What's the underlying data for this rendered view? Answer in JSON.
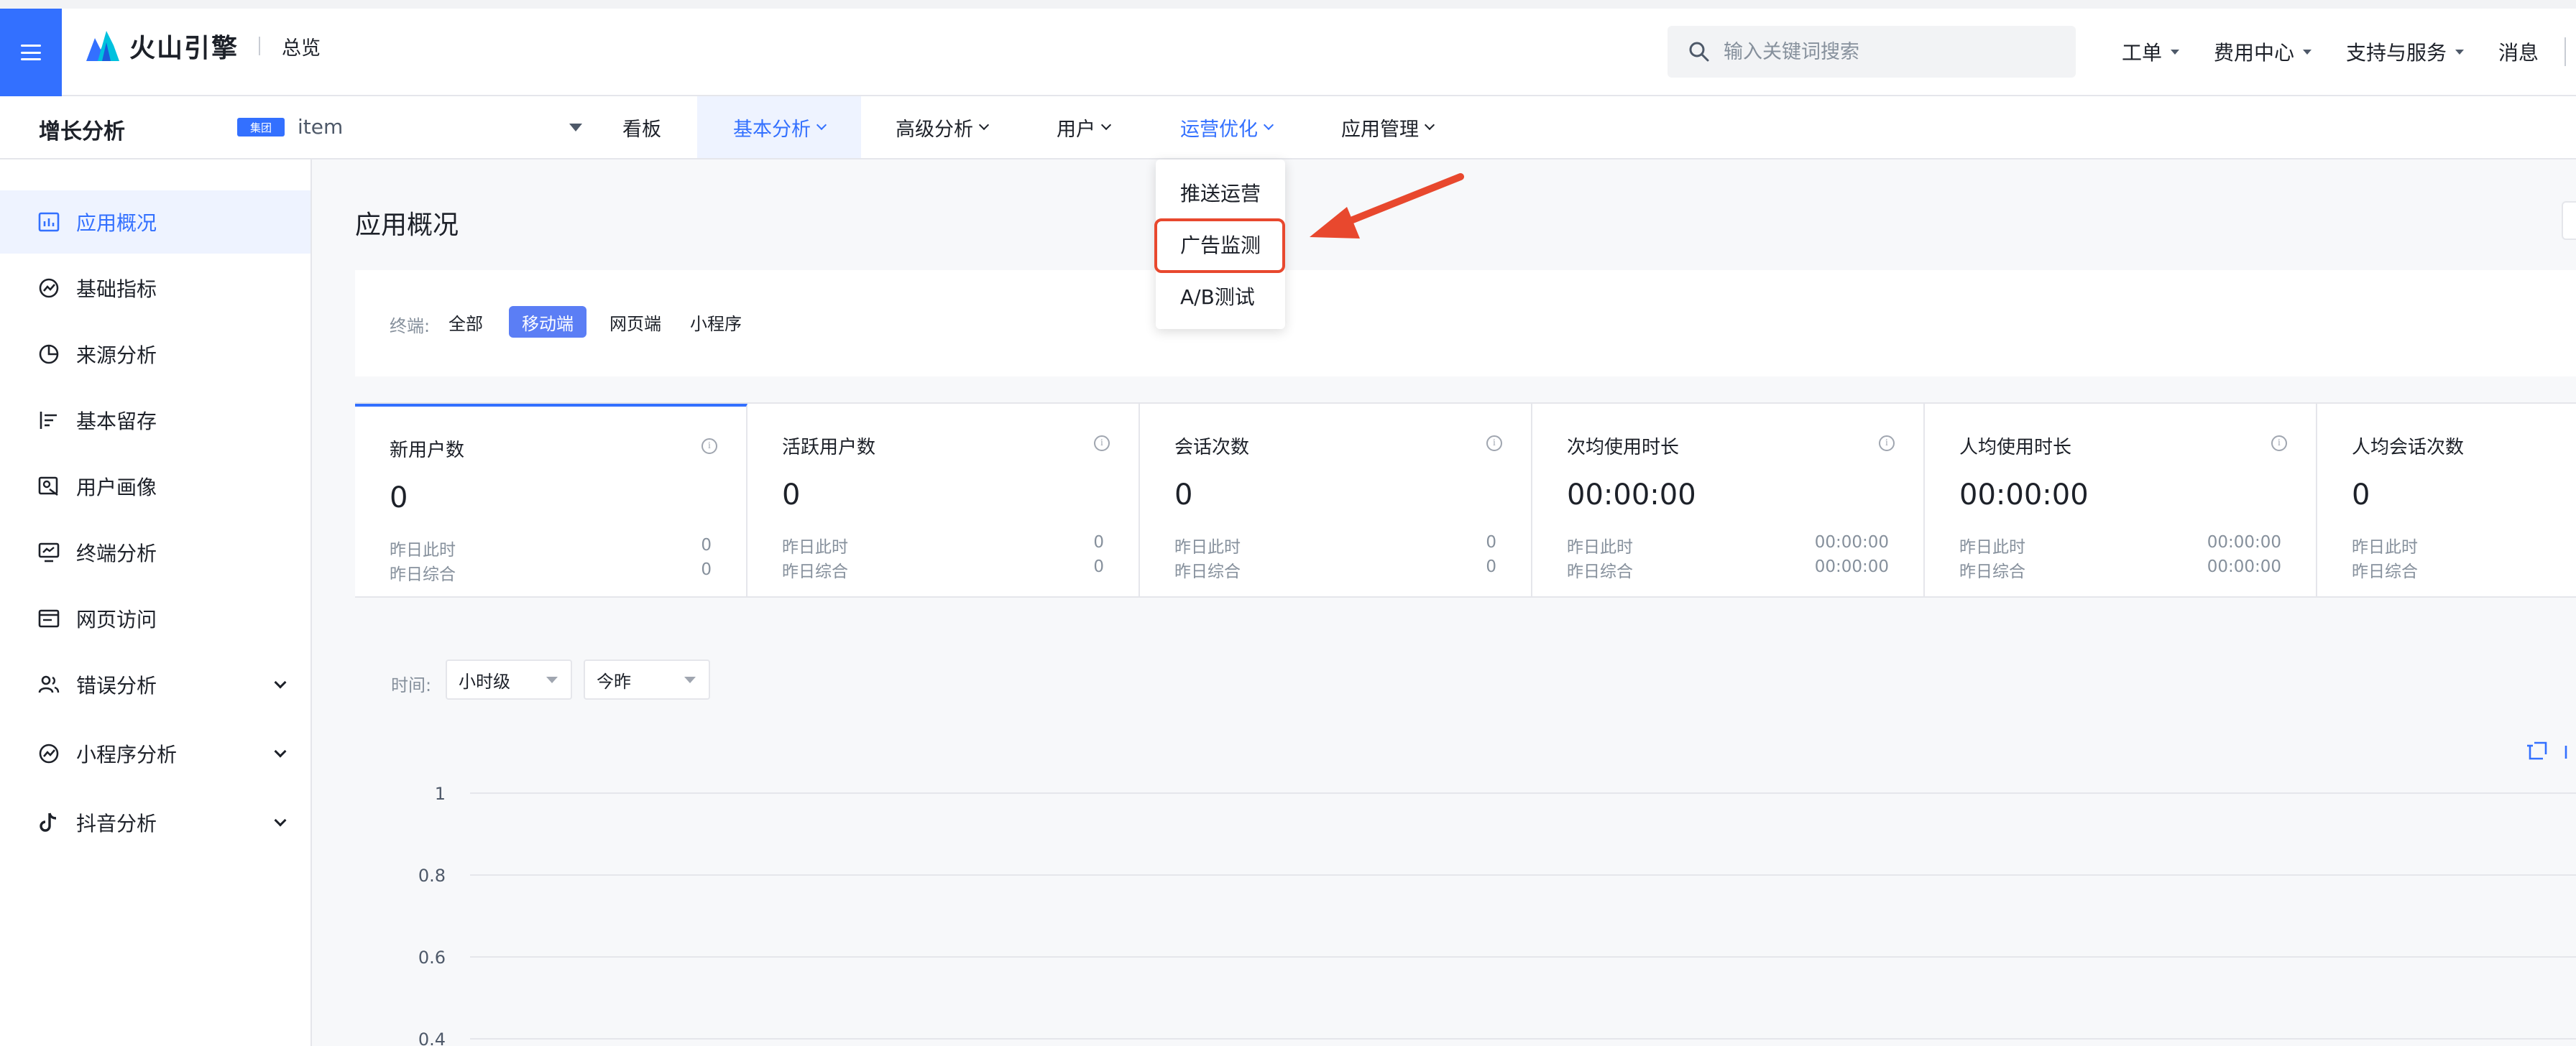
{
  "header": {
    "logo_text": "火山引擎",
    "section": "总览",
    "search_placeholder": "输入关键词搜索",
    "nav": [
      {
        "label": "工单"
      },
      {
        "label": "费用中心"
      },
      {
        "label": "支持与服务"
      },
      {
        "label": "消息"
      }
    ]
  },
  "subbar": {
    "product": "增长分析",
    "group_badge": "集团",
    "app": "item",
    "tabs": [
      {
        "label": "看板"
      },
      {
        "label": "基本分析"
      },
      {
        "label": "高级分析"
      },
      {
        "label": "用户"
      },
      {
        "label": "运营优化"
      },
      {
        "label": "应用管理"
      }
    ]
  },
  "sidebar": {
    "items": [
      {
        "label": "应用概况",
        "icon": "chart-icon"
      },
      {
        "label": "基础指标",
        "icon": "gauge-icon"
      },
      {
        "label": "来源分析",
        "icon": "pie-icon"
      },
      {
        "label": "基本留存",
        "icon": "bar-list-icon"
      },
      {
        "label": "用户画像",
        "icon": "profile-icon"
      },
      {
        "label": "终端分析",
        "icon": "monitor-icon"
      },
      {
        "label": "网页访问",
        "icon": "browser-icon"
      },
      {
        "label": "错误分析",
        "icon": "users-icon"
      },
      {
        "label": "小程序分析",
        "icon": "miniapp-icon"
      },
      {
        "label": "抖音分析",
        "icon": "tiktok-icon"
      }
    ]
  },
  "main": {
    "title": "应用概况",
    "terminal": {
      "label": "终端:",
      "options": [
        "全部",
        "移动端",
        "网页端",
        "小程序"
      ],
      "selected": "移动端"
    },
    "metrics": [
      {
        "title": "新用户数",
        "value": "0",
        "sub1_label": "昨日此时",
        "sub1_value": "0",
        "sub2_label": "昨日综合",
        "sub2_value": "0"
      },
      {
        "title": "活跃用户数",
        "value": "0",
        "sub1_label": "昨日此时",
        "sub1_value": "0",
        "sub2_label": "昨日综合",
        "sub2_value": "0"
      },
      {
        "title": "会话次数",
        "value": "0",
        "sub1_label": "昨日此时",
        "sub1_value": "0",
        "sub2_label": "昨日综合",
        "sub2_value": "0"
      },
      {
        "title": "次均使用时长",
        "value": "00:00:00",
        "sub1_label": "昨日此时",
        "sub1_value": "00:00:00",
        "sub2_label": "昨日综合",
        "sub2_value": "00:00:00"
      },
      {
        "title": "人均使用时长",
        "value": "00:00:00",
        "sub1_label": "昨日此时",
        "sub1_value": "00:00:00",
        "sub2_label": "昨日综合",
        "sub2_value": "00:00:00"
      },
      {
        "title": "人均会话次数",
        "value": "0",
        "sub1_label": "昨日此时",
        "sub1_value": "",
        "sub2_label": "昨日综合",
        "sub2_value": ""
      }
    ],
    "time": {
      "label": "时间:",
      "granularity": "小时级",
      "compare": "今昨"
    },
    "chart": {
      "y_ticks": [
        "1",
        "0.8",
        "0.6",
        "0.4"
      ]
    }
  },
  "dropdown": {
    "items": [
      "推送运营",
      "广告监测",
      "A/B测试"
    ],
    "highlighted": "广告监测"
  },
  "colors": {
    "primary": "#3370ff",
    "highlight": "#e8482e",
    "active_bg": "#eef3ff"
  }
}
